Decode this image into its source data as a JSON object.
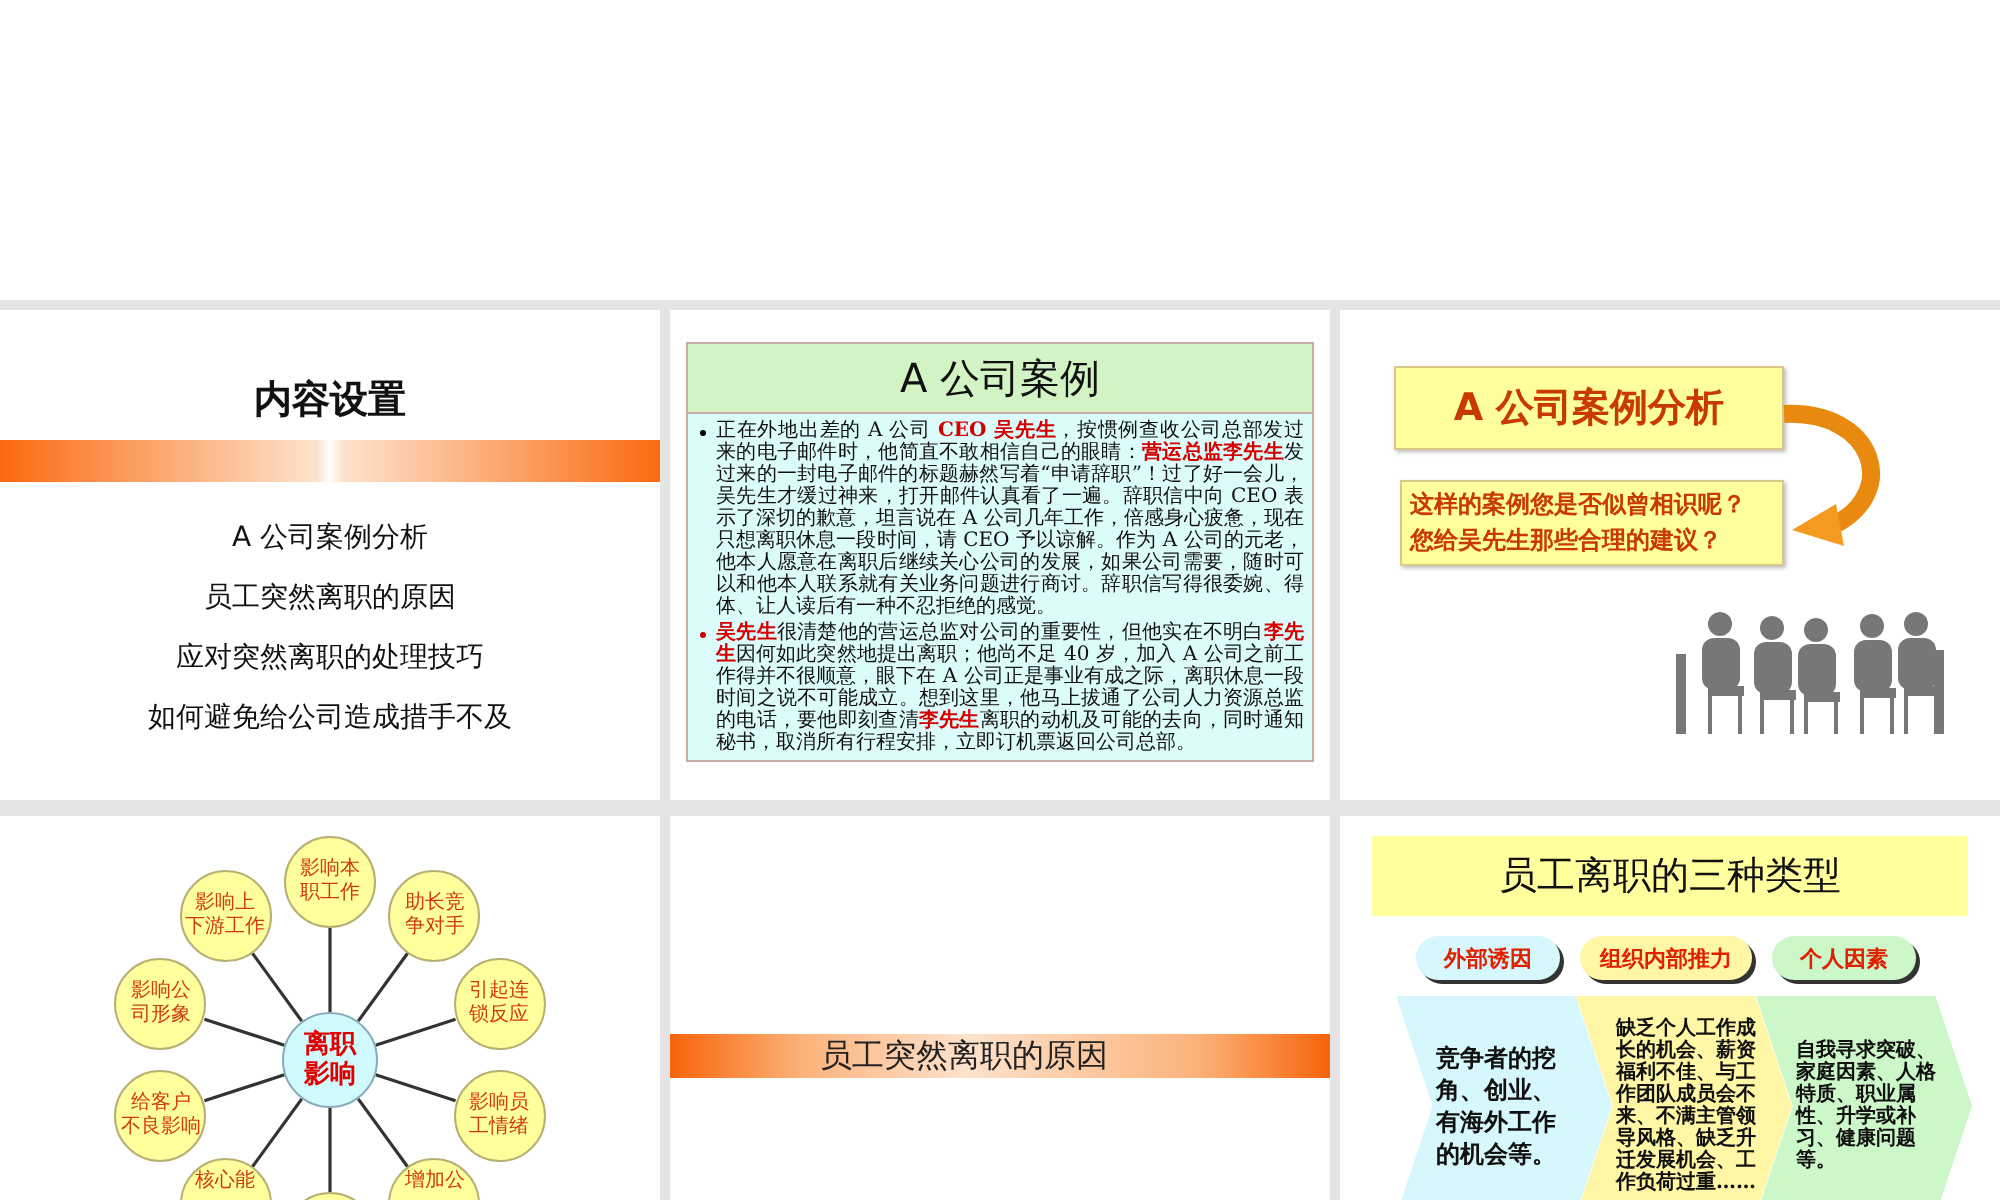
{
  "slides": [
    {
      "kind": "agenda",
      "title": "内容设置",
      "items": [
        "A 公司案例分析",
        "员工突然离职的原因",
        "应对突然离职的处理技巧",
        "如何避免给公司造成措手不及"
      ]
    },
    {
      "kind": "case",
      "title": "A 公司案例",
      "paragraphs": [
        {
          "color": "#000000",
          "text": "正在外地出差的 A 公司 **CEO 吴先生**，按惯例查收公司总部发过来的电子邮件时，他简直不敢相信自己的眼睛：**营运总监李先生**发过来的一封电子邮件的标题赫然写着“申请辞职”！过了好一会儿，吴先生才缓过神来，打开邮件认真看了一遍。辞职信中向 CEO 表示了深切的歉意，坦言说在 A 公司几年工作，倍感身心疲惫，现在只想离职休息一段时间，请 CEO 予以谅解。作为 A 公司的元老，他本人愿意在离职后继续关心公司的发展，如果公司需要，随时可以和他本人联系就有关业务问题进行商讨。辞职信写得很委婉、得体、让人读后有一种不忍拒绝的感觉。"
        },
        {
          "color": "#cc0000",
          "text": "**吴先生**很清楚他的营运总监对公司的重要性，但他实在不明白**李先生**因何如此突然地提出离职；他尚不足 40 岁，加入 A 公司之前工作得并不很顺意，眼下在 A 公司正是事业有成之际，离职休息一段时间之说不可能成立。想到这里，他马上拔通了公司人力资源总监的电话，要他即刻查清**李先生**离职的动机及可能的去向，同时通知秘书，取消所有行程安排，立即订机票返回公司总部。"
        }
      ]
    },
    {
      "kind": "analysis",
      "title": "A 公司案例分析",
      "questions": [
        "这样的案例您是否似曾相识呢？",
        "您给吴先生那些合理的建议？"
      ]
    },
    {
      "kind": "spoke",
      "center": "离职影响",
      "nodes": [
        {
          "kind": "label",
          "lines": [
            "影响本",
            "职工作"
          ]
        },
        {
          "kind": "label",
          "lines": [
            "影响上",
            "下游工作"
          ]
        },
        {
          "kind": "label",
          "lines": [
            "助长竞",
            "争对手"
          ]
        },
        {
          "kind": "label",
          "lines": [
            "影响公",
            "司形象"
          ]
        },
        {
          "kind": "label",
          "lines": [
            "引起连",
            "锁反应"
          ]
        },
        {
          "kind": "label",
          "lines": [
            "给客户",
            "不良影响"
          ]
        },
        {
          "kind": "label",
          "lines": [
            "影响员",
            "工情绪"
          ]
        },
        {
          "kind": "cut",
          "lines": [
            "核心能"
          ]
        },
        {
          "kind": "cut",
          "lines": [
            "增加公"
          ]
        },
        {
          "kind": "blank"
        }
      ]
    },
    {
      "kind": "section",
      "title": "员工突然离职的原因"
    },
    {
      "kind": "types",
      "title": "员工离职的三种类型",
      "columns": [
        {
          "tab": "外部诱因",
          "color": "#d6f7fb",
          "text": "竞争者的挖角、创业、有海外工作的机会等。"
        },
        {
          "tab": "组织内部推力",
          "color": "#fff6a6",
          "text": "缺乏个人工作成长的机会、薪资福利不佳、与工作团队成员会不来、不满主管领导风格、缺乏升迁发展机会、工作负荷过重……"
        },
        {
          "tab": "个人因素",
          "color": "#ccf7c8",
          "text": "自我寻求突破、家庭因素、人格特质、职业属性、升学或补习、健康问题等。"
        }
      ]
    }
  ]
}
